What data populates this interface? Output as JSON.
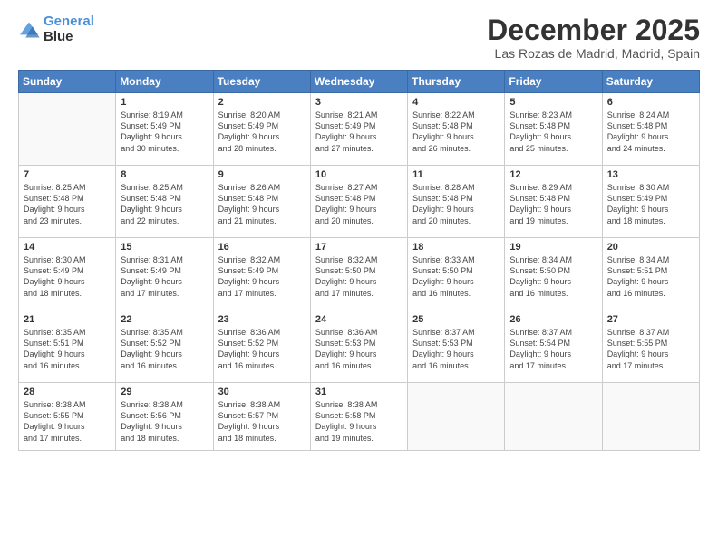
{
  "header": {
    "logo_line1": "General",
    "logo_line2": "Blue",
    "month": "December 2025",
    "location": "Las Rozas de Madrid, Madrid, Spain"
  },
  "weekdays": [
    "Sunday",
    "Monday",
    "Tuesday",
    "Wednesday",
    "Thursday",
    "Friday",
    "Saturday"
  ],
  "weeks": [
    [
      {
        "day": "",
        "info": ""
      },
      {
        "day": "1",
        "info": "Sunrise: 8:19 AM\nSunset: 5:49 PM\nDaylight: 9 hours\nand 30 minutes."
      },
      {
        "day": "2",
        "info": "Sunrise: 8:20 AM\nSunset: 5:49 PM\nDaylight: 9 hours\nand 28 minutes."
      },
      {
        "day": "3",
        "info": "Sunrise: 8:21 AM\nSunset: 5:49 PM\nDaylight: 9 hours\nand 27 minutes."
      },
      {
        "day": "4",
        "info": "Sunrise: 8:22 AM\nSunset: 5:48 PM\nDaylight: 9 hours\nand 26 minutes."
      },
      {
        "day": "5",
        "info": "Sunrise: 8:23 AM\nSunset: 5:48 PM\nDaylight: 9 hours\nand 25 minutes."
      },
      {
        "day": "6",
        "info": "Sunrise: 8:24 AM\nSunset: 5:48 PM\nDaylight: 9 hours\nand 24 minutes."
      }
    ],
    [
      {
        "day": "7",
        "info": "Sunrise: 8:25 AM\nSunset: 5:48 PM\nDaylight: 9 hours\nand 23 minutes."
      },
      {
        "day": "8",
        "info": "Sunrise: 8:25 AM\nSunset: 5:48 PM\nDaylight: 9 hours\nand 22 minutes."
      },
      {
        "day": "9",
        "info": "Sunrise: 8:26 AM\nSunset: 5:48 PM\nDaylight: 9 hours\nand 21 minutes."
      },
      {
        "day": "10",
        "info": "Sunrise: 8:27 AM\nSunset: 5:48 PM\nDaylight: 9 hours\nand 20 minutes."
      },
      {
        "day": "11",
        "info": "Sunrise: 8:28 AM\nSunset: 5:48 PM\nDaylight: 9 hours\nand 20 minutes."
      },
      {
        "day": "12",
        "info": "Sunrise: 8:29 AM\nSunset: 5:48 PM\nDaylight: 9 hours\nand 19 minutes."
      },
      {
        "day": "13",
        "info": "Sunrise: 8:30 AM\nSunset: 5:49 PM\nDaylight: 9 hours\nand 18 minutes."
      }
    ],
    [
      {
        "day": "14",
        "info": "Sunrise: 8:30 AM\nSunset: 5:49 PM\nDaylight: 9 hours\nand 18 minutes."
      },
      {
        "day": "15",
        "info": "Sunrise: 8:31 AM\nSunset: 5:49 PM\nDaylight: 9 hours\nand 17 minutes."
      },
      {
        "day": "16",
        "info": "Sunrise: 8:32 AM\nSunset: 5:49 PM\nDaylight: 9 hours\nand 17 minutes."
      },
      {
        "day": "17",
        "info": "Sunrise: 8:32 AM\nSunset: 5:50 PM\nDaylight: 9 hours\nand 17 minutes."
      },
      {
        "day": "18",
        "info": "Sunrise: 8:33 AM\nSunset: 5:50 PM\nDaylight: 9 hours\nand 16 minutes."
      },
      {
        "day": "19",
        "info": "Sunrise: 8:34 AM\nSunset: 5:50 PM\nDaylight: 9 hours\nand 16 minutes."
      },
      {
        "day": "20",
        "info": "Sunrise: 8:34 AM\nSunset: 5:51 PM\nDaylight: 9 hours\nand 16 minutes."
      }
    ],
    [
      {
        "day": "21",
        "info": "Sunrise: 8:35 AM\nSunset: 5:51 PM\nDaylight: 9 hours\nand 16 minutes."
      },
      {
        "day": "22",
        "info": "Sunrise: 8:35 AM\nSunset: 5:52 PM\nDaylight: 9 hours\nand 16 minutes."
      },
      {
        "day": "23",
        "info": "Sunrise: 8:36 AM\nSunset: 5:52 PM\nDaylight: 9 hours\nand 16 minutes."
      },
      {
        "day": "24",
        "info": "Sunrise: 8:36 AM\nSunset: 5:53 PM\nDaylight: 9 hours\nand 16 minutes."
      },
      {
        "day": "25",
        "info": "Sunrise: 8:37 AM\nSunset: 5:53 PM\nDaylight: 9 hours\nand 16 minutes."
      },
      {
        "day": "26",
        "info": "Sunrise: 8:37 AM\nSunset: 5:54 PM\nDaylight: 9 hours\nand 17 minutes."
      },
      {
        "day": "27",
        "info": "Sunrise: 8:37 AM\nSunset: 5:55 PM\nDaylight: 9 hours\nand 17 minutes."
      }
    ],
    [
      {
        "day": "28",
        "info": "Sunrise: 8:38 AM\nSunset: 5:55 PM\nDaylight: 9 hours\nand 17 minutes."
      },
      {
        "day": "29",
        "info": "Sunrise: 8:38 AM\nSunset: 5:56 PM\nDaylight: 9 hours\nand 18 minutes."
      },
      {
        "day": "30",
        "info": "Sunrise: 8:38 AM\nSunset: 5:57 PM\nDaylight: 9 hours\nand 18 minutes."
      },
      {
        "day": "31",
        "info": "Sunrise: 8:38 AM\nSunset: 5:58 PM\nDaylight: 9 hours\nand 19 minutes."
      },
      {
        "day": "",
        "info": ""
      },
      {
        "day": "",
        "info": ""
      },
      {
        "day": "",
        "info": ""
      }
    ]
  ]
}
